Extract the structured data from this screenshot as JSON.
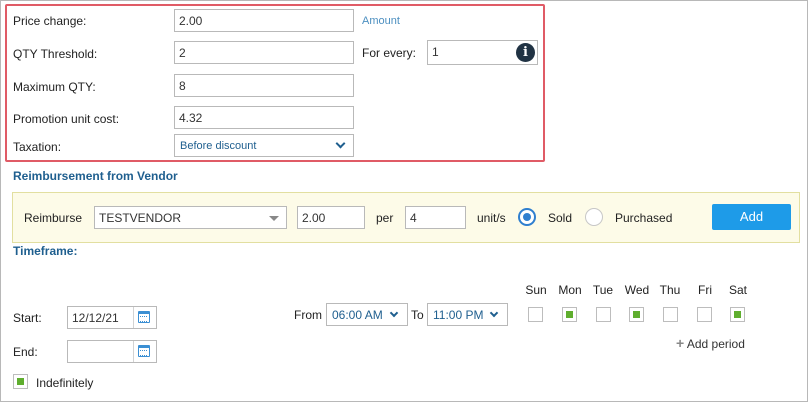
{
  "pricing": {
    "price_change_label": "Price change:",
    "price_change_value": "2.00",
    "amount_link": "Amount",
    "qty_threshold_label": "QTY Threshold:",
    "qty_threshold_value": "2",
    "for_every_label": "For every:",
    "for_every_value": "1",
    "max_qty_label": "Maximum QTY:",
    "max_qty_value": "8",
    "unit_cost_label": "Promotion unit cost:",
    "unit_cost_value": "4.32",
    "taxation_label": "Taxation:",
    "taxation_value": "Before discount"
  },
  "reimbursement": {
    "title": "Reimbursement from Vendor",
    "reimburse_label": "Reimburse",
    "vendor": "TESTVENDOR",
    "amount": "2.00",
    "per_label": "per",
    "units": "4",
    "unit_label": "unit/s",
    "sold_label": "Sold",
    "purchased_label": "Purchased",
    "selected": "Sold",
    "add_button": "Add"
  },
  "timeframe": {
    "title": "Timeframe:",
    "start_label": "Start:",
    "start_value": "12/12/21",
    "end_label": "End:",
    "end_value": "",
    "indefinitely_label": "Indefinitely",
    "indefinitely_checked": true,
    "from_label": "From",
    "from_value": "06:00 AM",
    "to_label": "To",
    "to_value": "11:00 PM",
    "add_period": "Add period",
    "days": [
      {
        "label": "Sun",
        "checked": false
      },
      {
        "label": "Mon",
        "checked": true
      },
      {
        "label": "Tue",
        "checked": false
      },
      {
        "label": "Wed",
        "checked": true
      },
      {
        "label": "Thu",
        "checked": false
      },
      {
        "label": "Fri",
        "checked": false
      },
      {
        "label": "Sat",
        "checked": true
      }
    ]
  },
  "colors": {
    "highlight_border": "#e05b66",
    "section_title": "#1f5f8f",
    "add_button": "#1e9be8",
    "checked_green": "#5fae2e",
    "panel_bg": "#fdfbe8"
  },
  "icons": [
    "info-icon",
    "calendar-icon",
    "chevron-down-icon",
    "plus-icon",
    "caret-down-icon"
  ]
}
